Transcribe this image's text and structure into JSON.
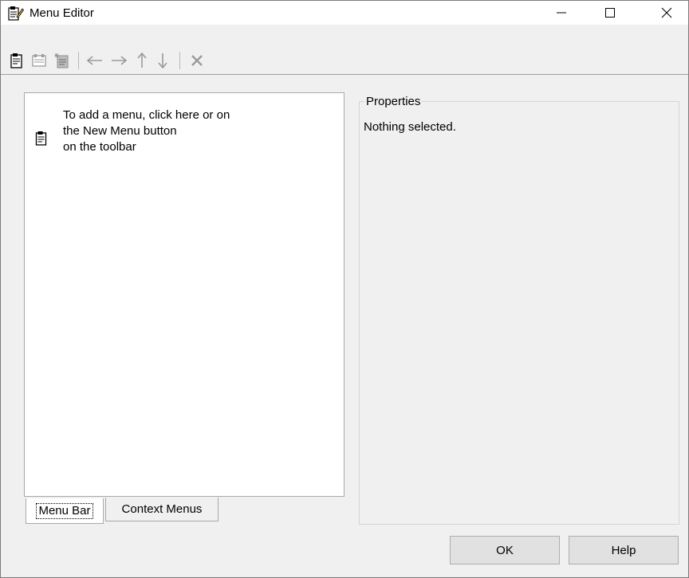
{
  "window": {
    "title": "Menu Editor",
    "controls": {
      "minimize": "—",
      "maximize": "☐",
      "close": "✕"
    }
  },
  "toolbar": {
    "items": [
      {
        "name": "new-menu-button",
        "icon": "new-menu-icon"
      },
      {
        "name": "new-menu-item-button",
        "icon": "new-menu-item-icon"
      },
      {
        "name": "new-context-menu-button",
        "icon": "new-context-menu-icon"
      },
      {
        "name": "move-left-button",
        "icon": "arrow-left-icon"
      },
      {
        "name": "move-right-button",
        "icon": "arrow-right-icon"
      },
      {
        "name": "move-up-button",
        "icon": "arrow-up-icon"
      },
      {
        "name": "move-down-button",
        "icon": "arrow-down-icon"
      },
      {
        "name": "delete-button",
        "icon": "delete-icon"
      }
    ]
  },
  "menu_tree": {
    "hint": "To add a menu, click here or on\nthe New Menu button\non the toolbar"
  },
  "tabs": [
    {
      "label": "Menu Bar",
      "active": true
    },
    {
      "label": "Context Menus",
      "active": false
    }
  ],
  "properties": {
    "legend": "Properties",
    "value": "Nothing selected."
  },
  "buttons": {
    "ok": "OK",
    "help": "Help"
  }
}
